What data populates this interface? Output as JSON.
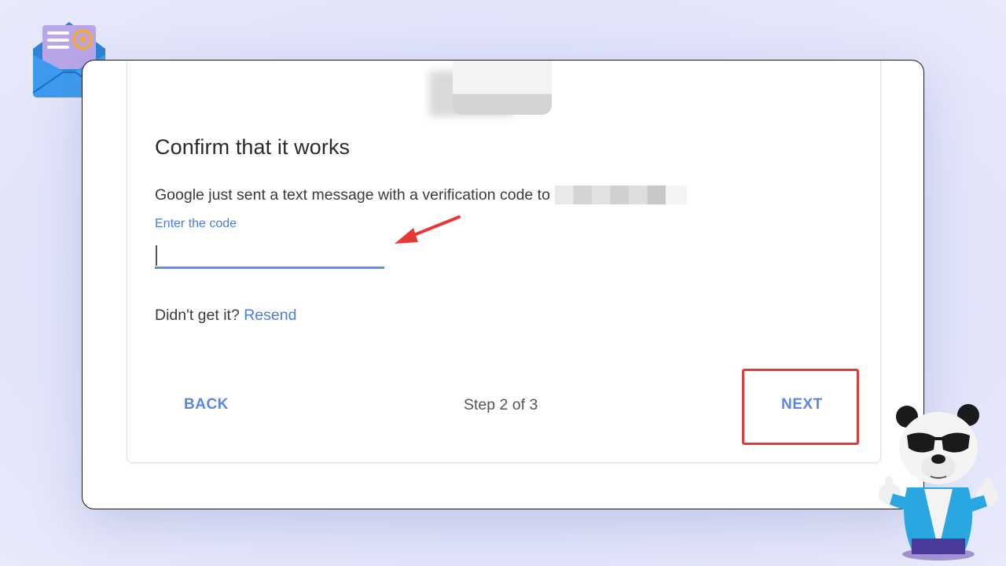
{
  "dialog": {
    "title": "Confirm that it works",
    "message": "Google just sent a text message with a verification code to",
    "code_label": "Enter the code",
    "code_value": "",
    "resend_prompt": "Didn't get it?",
    "resend_link": "Resend",
    "back_label": "BACK",
    "step_text": "Step 2 of 3",
    "next_label": "NEXT"
  },
  "colors": {
    "accent": "#4a7de3",
    "highlight": "#e53935",
    "arrow": "#e53935"
  },
  "decorations": {
    "top_left_icon": "email-envelope-icon",
    "bottom_right_mascot": "panda-thumbs-up-icon"
  }
}
